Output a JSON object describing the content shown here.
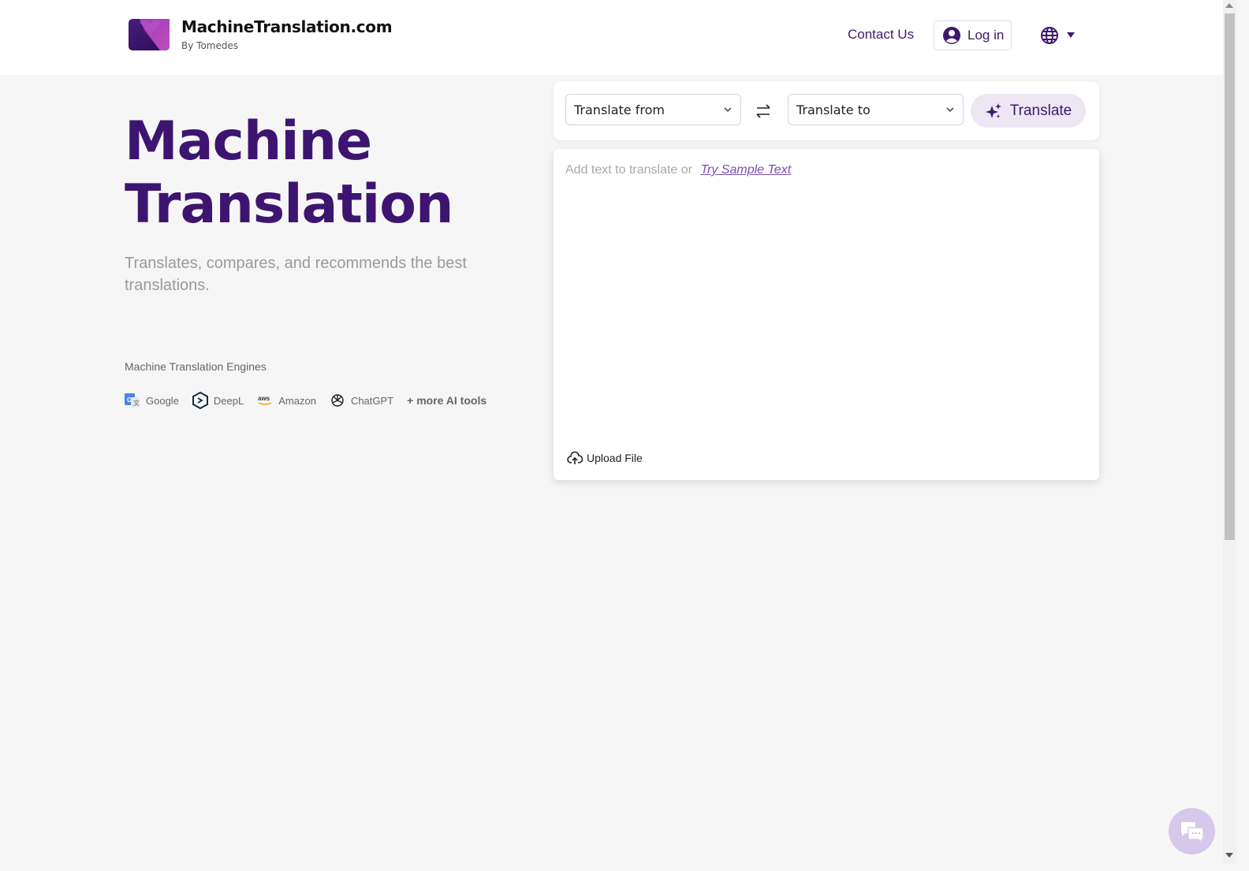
{
  "header": {
    "brand_name": "MachineTranslation.com",
    "brand_sub": "By Tomedes",
    "contact_label": "Contact Us",
    "login_label": "Log in",
    "language_icon": "globe-icon"
  },
  "hero": {
    "title_line1": "Machine",
    "title_line2": "Translation",
    "subtitle": "Translates, compares, and recommends the best translations.",
    "engines_label": "Machine Translation Engines",
    "engines": [
      {
        "name": "Google",
        "icon": "google-translate-icon"
      },
      {
        "name": "DeepL",
        "icon": "deepl-icon"
      },
      {
        "name": "Amazon",
        "icon": "aws-icon"
      },
      {
        "name": "ChatGPT",
        "icon": "chatgpt-icon"
      }
    ],
    "more_tools": "+ more AI tools"
  },
  "translator": {
    "from_label": "Translate from",
    "to_label": "Translate to",
    "translate_button": "Translate",
    "placeholder": "Add text to translate or",
    "sample_link": "Try Sample Text",
    "upload_label": "Upload File"
  },
  "colors": {
    "brand_purple": "#3d1571",
    "accent_light": "#ece7f3",
    "link": "#7a4fb0",
    "chat_bubble": "#d6c8ea"
  }
}
